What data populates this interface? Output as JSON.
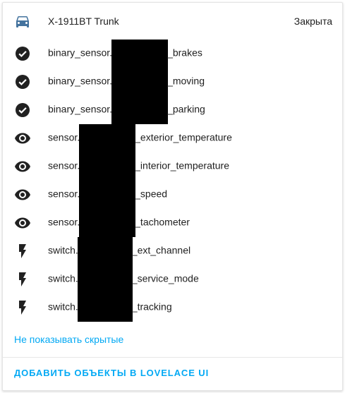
{
  "header": {
    "icon": "car-icon",
    "name": "X-1911BT Trunk",
    "state": "Закрыта"
  },
  "entities": [
    {
      "icon": "check-circle-icon",
      "prefix": "binary_sensor.",
      "suffix": "_brakes"
    },
    {
      "icon": "check-circle-icon",
      "prefix": "binary_sensor.",
      "suffix": "_moving"
    },
    {
      "icon": "check-circle-icon",
      "prefix": "binary_sensor.",
      "suffix": "_parking"
    },
    {
      "icon": "eye-icon",
      "prefix": "sensor.",
      "suffix": "_exterior_temperature"
    },
    {
      "icon": "eye-icon",
      "prefix": "sensor.",
      "suffix": "_interior_temperature"
    },
    {
      "icon": "eye-icon",
      "prefix": "sensor.",
      "suffix": "_speed"
    },
    {
      "icon": "eye-icon",
      "prefix": "sensor.",
      "suffix": "_tachometer"
    },
    {
      "icon": "flash-icon",
      "prefix": "switch.",
      "suffix": "_ext_channel"
    },
    {
      "icon": "flash-icon",
      "prefix": "switch.",
      "suffix": "_service_mode"
    },
    {
      "icon": "flash-icon",
      "prefix": "switch.",
      "suffix": "_tracking"
    }
  ],
  "hide_hidden_link": "Не показывать скрытые",
  "add_to_lovelace_button": "Добавить объекты в Lovelace UI",
  "colors": {
    "icon": "#44739e",
    "link": "#03a9f4",
    "text": "#212121"
  }
}
